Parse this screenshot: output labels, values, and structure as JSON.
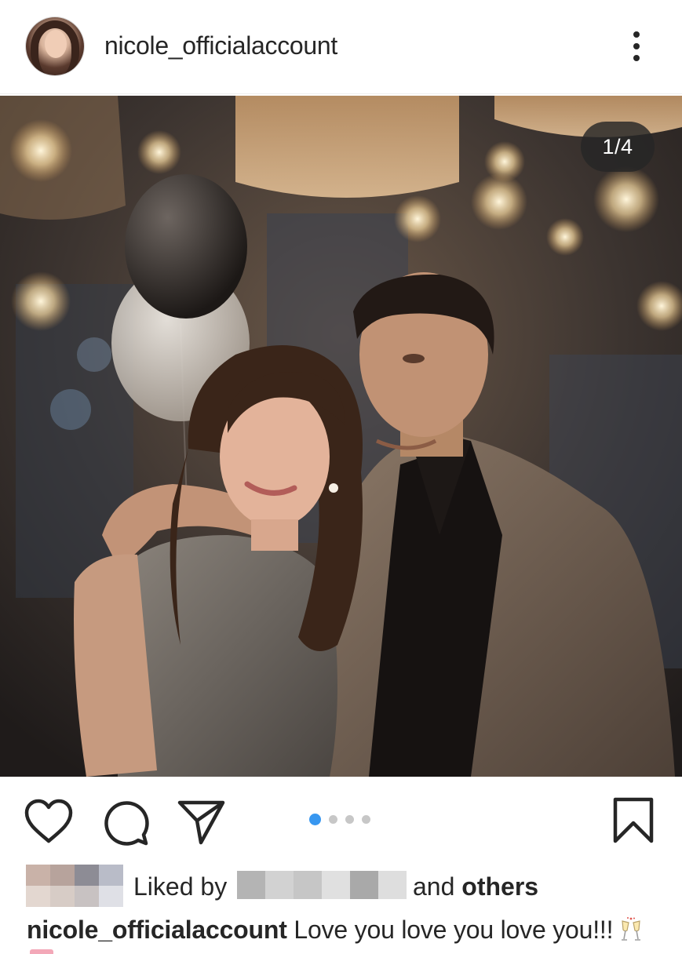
{
  "header": {
    "username": "nicole_officialaccount",
    "more_icon": "more-vertical-icon"
  },
  "photo": {
    "counter": "1/4",
    "current_index": 1,
    "total": 4
  },
  "actions": {
    "like_icon": "heart-outline-icon",
    "comment_icon": "comment-bubble-icon",
    "share_icon": "paper-plane-icon",
    "save_icon": "bookmark-outline-icon",
    "active_dot_color": "#3897f0",
    "inactive_dot_color": "#c7c7c7"
  },
  "likes": {
    "prefix": "Liked by",
    "connector": "and",
    "suffix": "others"
  },
  "caption": {
    "username": "nicole_officialaccount",
    "text": "Love you love you love you!!!",
    "emoji_icon": "champagne-glasses-icon"
  }
}
